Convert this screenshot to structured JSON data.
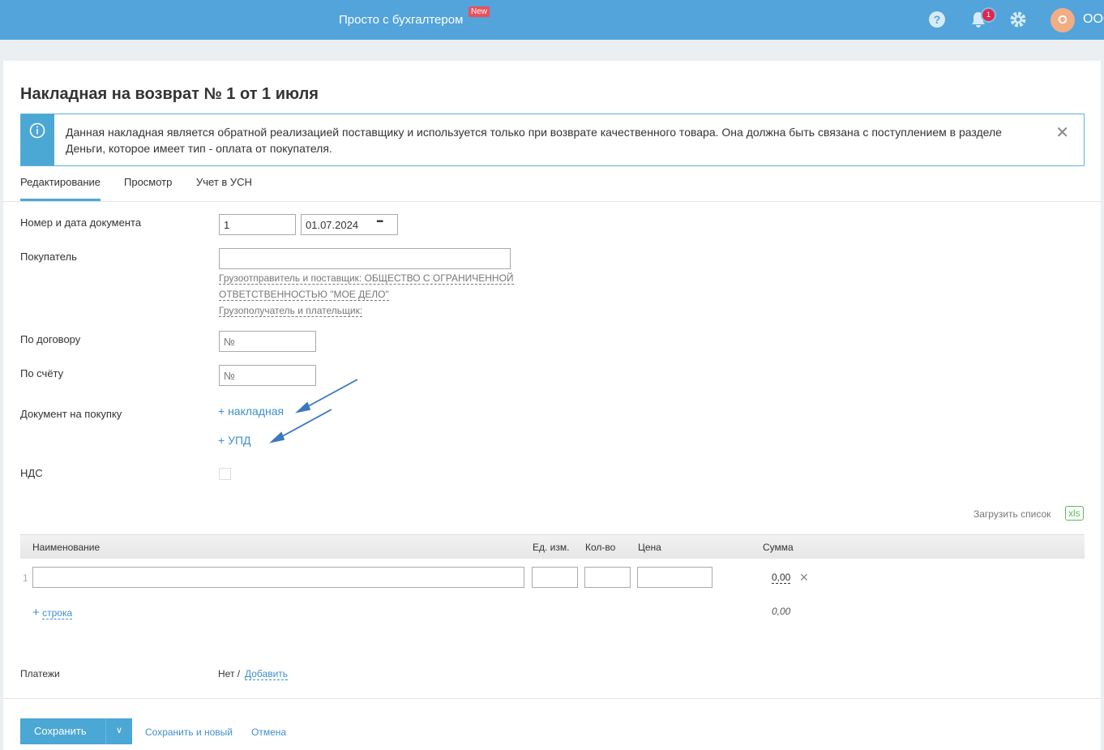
{
  "header": {
    "brand": "Просто с бухгалтером",
    "new_badge": "New",
    "notifications": "1",
    "avatar": "О",
    "org": "ООО"
  },
  "page": {
    "title": "Накладная на возврат № 1 от 1 июля",
    "info": "Данная накладная является обратной реализацией поставщику и используется только при возврате качественного товара. Она должна быть связана с поступлением в разделе Деньги, которое имеет тип - оплата от покупателя.",
    "tabs": [
      "Редактирование",
      "Просмотр",
      "Учет в УСН"
    ]
  },
  "form": {
    "doc_label": "Номер и дата документа",
    "doc_number": "1",
    "doc_date": "01.07.2024",
    "buyer_label": "Покупатель",
    "buyer_value": "",
    "shipper_hint": "Грузоотправитель и поставщик: ОБЩЕСТВО С ОГРАНИЧЕННОЙ",
    "shipper_hint2": "ОТВЕТСТВЕННОСТЬЮ \"МОЕ ДЕЛО\"",
    "consignee_hint": "Грузополучатель и плательщик:",
    "contract_label": "По договору",
    "contract_placeholder": "№",
    "invoice_label": "По счёту",
    "invoice_placeholder": "№",
    "purchase_doc_label": "Документ на покупку",
    "add_waybill": "+ накладная",
    "add_upd": "+ УПД",
    "vat_label": "НДС"
  },
  "table": {
    "upload_label": "Загрузить список",
    "xls": "xls",
    "headers": [
      "Наименование",
      "Ед. изм.",
      "Кол-во",
      "Цена",
      "Сумма"
    ],
    "rows": [
      {
        "num": "1",
        "sum": "0,00"
      }
    ],
    "add_row": "строка",
    "total": "0,00"
  },
  "payments": {
    "label": "Платежи",
    "none": "Нет /",
    "add": "Добавить"
  },
  "actions": {
    "save": "Сохранить",
    "save_new": "Сохранить и новый",
    "cancel": "Отмена"
  }
}
